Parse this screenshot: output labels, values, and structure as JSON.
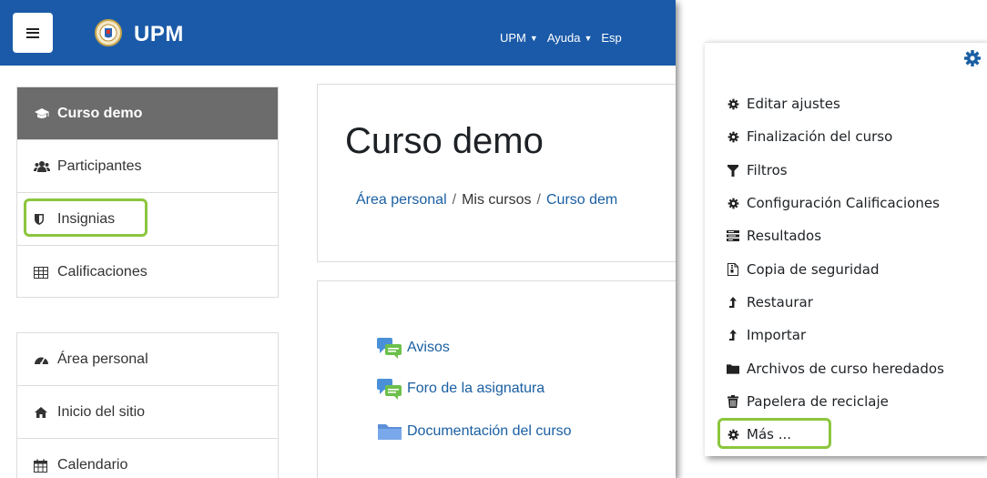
{
  "navbar": {
    "brand": "UPM",
    "menus": [
      {
        "label": "UPM"
      },
      {
        "label": "Ayuda"
      },
      {
        "label": "Esp"
      }
    ]
  },
  "sidebar": {
    "course_items": [
      {
        "label": "Curso demo",
        "icon": "graduation-cap-icon",
        "active": true
      },
      {
        "label": "Participantes",
        "icon": "users-icon"
      },
      {
        "label": "Insignias",
        "icon": "shield-icon"
      },
      {
        "label": "Calificaciones",
        "icon": "table-icon"
      }
    ],
    "site_items": [
      {
        "label": "Área personal",
        "icon": "dashboard-icon"
      },
      {
        "label": "Inicio del sitio",
        "icon": "home-icon"
      },
      {
        "label": "Calendario",
        "icon": "calendar-icon"
      }
    ]
  },
  "page": {
    "title": "Curso demo",
    "breadcrumb": [
      "Área personal",
      "Mis cursos",
      "Curso dem"
    ]
  },
  "activities": [
    {
      "label": "Avisos",
      "icon": "forum-icon"
    },
    {
      "label": "Foro de la asignatura",
      "icon": "forum-icon"
    },
    {
      "label": "Documentación del curso",
      "icon": "folder-icon"
    }
  ],
  "settings_menu": {
    "items": [
      {
        "label": "Editar ajustes",
        "icon": "gear-icon"
      },
      {
        "label": "Finalización del curso",
        "icon": "gear-icon"
      },
      {
        "label": "Filtros",
        "icon": "filter-icon"
      },
      {
        "label": "Configuración Calificaciones",
        "icon": "gear-icon"
      },
      {
        "label": "Resultados",
        "icon": "list-icon"
      },
      {
        "label": "Copia de seguridad",
        "icon": "file-archive-icon"
      },
      {
        "label": "Restaurar",
        "icon": "level-up-icon"
      },
      {
        "label": "Importar",
        "icon": "level-up-icon"
      },
      {
        "label": "Archivos de curso heredados",
        "icon": "folder-icon"
      },
      {
        "label": "Papelera de reciclaje",
        "icon": "trash-icon"
      },
      {
        "label": "Más ...",
        "icon": "gear-icon"
      }
    ]
  },
  "colors": {
    "navbar": "#1b5aa8",
    "link": "#1a5fa3",
    "highlight": "#8cc63e",
    "active_item": "#6c6c6c"
  }
}
